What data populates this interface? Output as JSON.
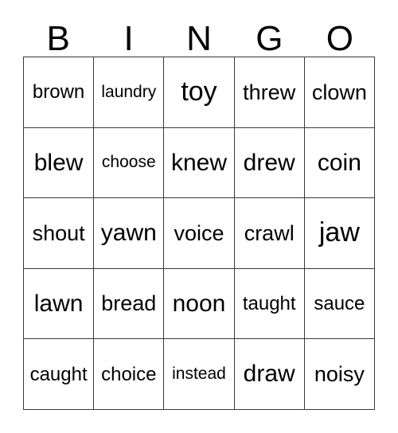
{
  "card": {
    "header": {
      "letters": [
        "B",
        "I",
        "N",
        "G",
        "O"
      ]
    },
    "grid": {
      "columns": 5,
      "rows": 5,
      "border_color": "#3a3a3a",
      "background_color": "#ffffff",
      "text_color": "#000000",
      "cells": [
        {
          "word": "brown",
          "size": "sm"
        },
        {
          "word": "laundry",
          "size": "xs"
        },
        {
          "word": "toy",
          "size": "xl"
        },
        {
          "word": "threw",
          "size": "md"
        },
        {
          "word": "clown",
          "size": "md"
        },
        {
          "word": "blew",
          "size": "lg"
        },
        {
          "word": "choose",
          "size": "xs"
        },
        {
          "word": "knew",
          "size": "lg"
        },
        {
          "word": "drew",
          "size": "lg"
        },
        {
          "word": "coin",
          "size": "lg"
        },
        {
          "word": "shout",
          "size": "md"
        },
        {
          "word": "yawn",
          "size": "lg"
        },
        {
          "word": "voice",
          "size": "md"
        },
        {
          "word": "crawl",
          "size": "md"
        },
        {
          "word": "jaw",
          "size": "xl"
        },
        {
          "word": "lawn",
          "size": "lg"
        },
        {
          "word": "bread",
          "size": "md"
        },
        {
          "word": "noon",
          "size": "lg"
        },
        {
          "word": "taught",
          "size": "sm"
        },
        {
          "word": "sauce",
          "size": "sm"
        },
        {
          "word": "caught",
          "size": "sm"
        },
        {
          "word": "choice",
          "size": "sm"
        },
        {
          "word": "instead",
          "size": "xs"
        },
        {
          "word": "draw",
          "size": "lg"
        },
        {
          "word": "noisy",
          "size": "md"
        }
      ]
    }
  }
}
